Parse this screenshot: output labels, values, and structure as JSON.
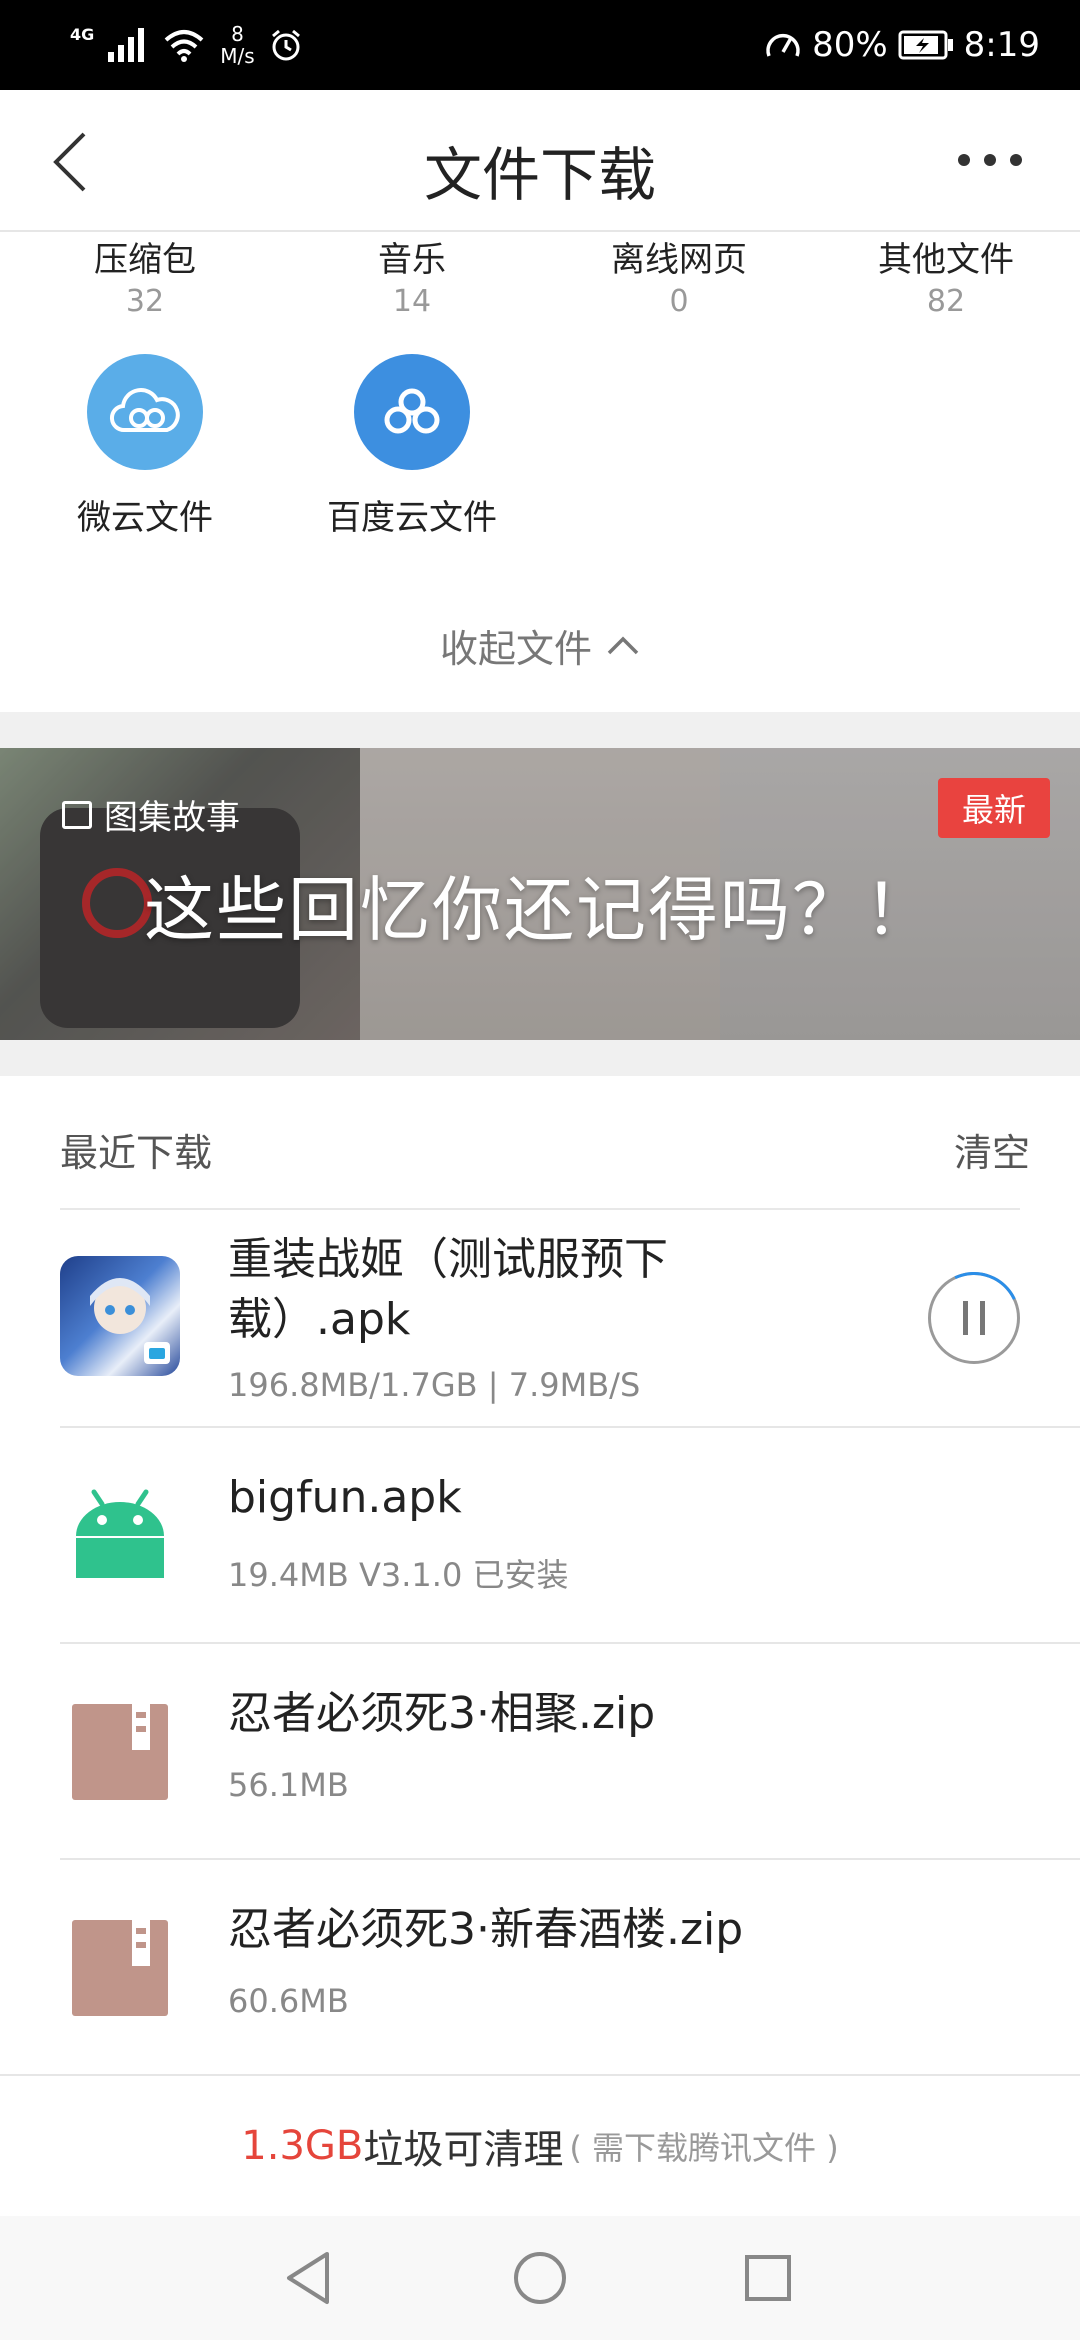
{
  "status_bar": {
    "network": "4G",
    "speed_value": "8",
    "speed_unit": "M/s",
    "battery": "80%",
    "time": "8:19"
  },
  "header": {
    "title": "文件下载"
  },
  "categories": [
    {
      "name": "压缩包",
      "count": "32"
    },
    {
      "name": "音乐",
      "count": "14"
    },
    {
      "name": "离线网页",
      "count": "0"
    },
    {
      "name": "其他文件",
      "count": "82"
    }
  ],
  "cloud_services": [
    {
      "label": "微云文件",
      "color": "#5aade8"
    },
    {
      "label": "百度云文件",
      "color": "#3d8fe0"
    }
  ],
  "collapse_label": "收起文件",
  "banner": {
    "tag": "图集故事",
    "title": "这些回忆你还记得吗？！",
    "badge": "最新"
  },
  "recent": {
    "title": "最近下载",
    "clear_label": "清空"
  },
  "downloads": [
    {
      "name": "重装战姬（测试服预下载）.apk",
      "info": "196.8MB/1.7GB | 7.9MB/S",
      "icon": "game-app-icon",
      "status": "downloading"
    },
    {
      "name": "bigfun.apk",
      "info": "19.4MB  V3.1.0 已安装",
      "icon": "android-icon",
      "status": "installed"
    },
    {
      "name": "忍者必须死3·相聚.zip",
      "info": "56.1MB",
      "icon": "zip-icon",
      "status": "done"
    },
    {
      "name": "忍者必须死3·新春酒楼.zip",
      "info": "60.6MB",
      "icon": "zip-icon",
      "status": "done"
    }
  ],
  "cleanup": {
    "amount": "1.3GB",
    "text": "垃圾可清理",
    "note": "( 需下载腾讯文件 )"
  },
  "colors": {
    "accent_red": "#e5453b",
    "android_green": "#2fc28d",
    "zip_brown": "#c0958a",
    "progress_blue": "#2b8ee8"
  }
}
